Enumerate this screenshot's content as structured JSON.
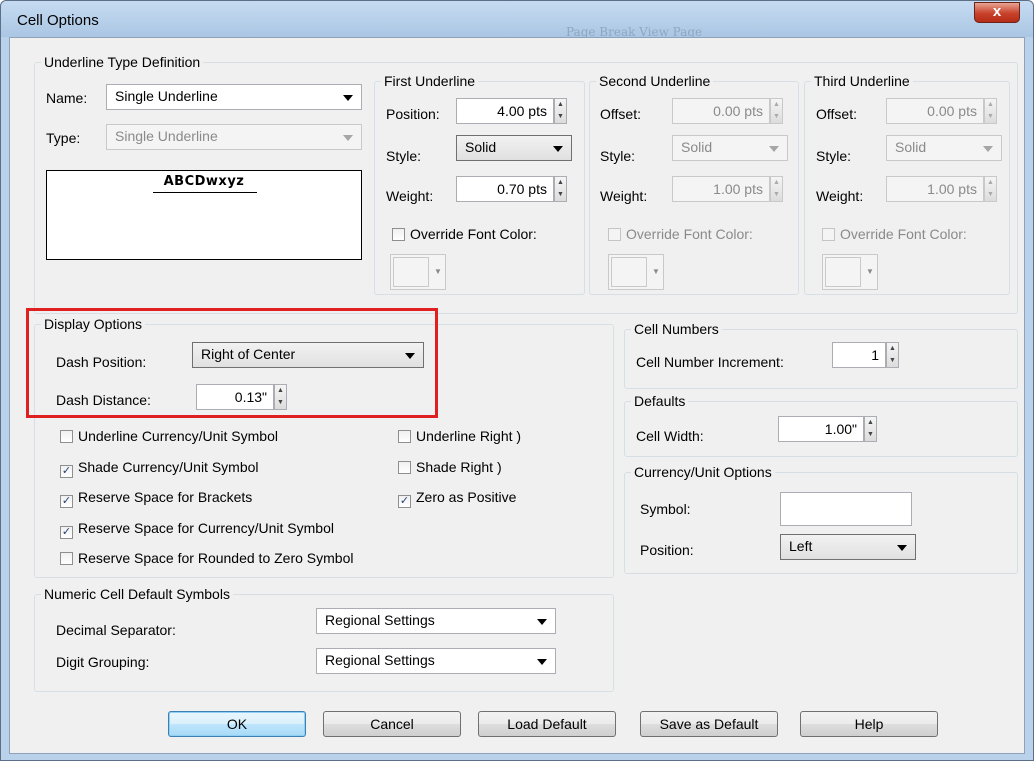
{
  "window": {
    "title": "Cell Options",
    "ghost_title": "Page Break View Page",
    "close_glyph": "x"
  },
  "underline_def": {
    "legend": "Underline Type Definition",
    "name_label": "Name:",
    "name_value": "Single Underline",
    "type_label": "Type:",
    "type_value": "Single Underline",
    "preview_text": "ABCDwxyz"
  },
  "first_underline": {
    "legend": "First Underline",
    "position_label": "Position:",
    "position_value": "4.00 pts",
    "style_label": "Style:",
    "style_value": "Solid",
    "weight_label": "Weight:",
    "weight_value": "0.70 pts",
    "override_label": "Override Font Color:"
  },
  "second_underline": {
    "legend": "Second Underline",
    "offset_label": "Offset:",
    "offset_value": "0.00 pts",
    "style_label": "Style:",
    "style_value": "Solid",
    "weight_label": "Weight:",
    "weight_value": "1.00 pts",
    "override_label": "Override Font Color:"
  },
  "third_underline": {
    "legend": "Third Underline",
    "offset_label": "Offset:",
    "offset_value": "0.00 pts",
    "style_label": "Style:",
    "style_value": "Solid",
    "weight_label": "Weight:",
    "weight_value": "1.00 pts",
    "override_label": "Override Font Color:"
  },
  "display_options": {
    "legend": "Display Options",
    "dash_position_label": "Dash Position:",
    "dash_position_value": "Right of Center",
    "dash_distance_label": "Dash Distance:",
    "dash_distance_value": "0.13\"",
    "checkboxes": [
      {
        "label": "Underline Currency/Unit Symbol",
        "checked": false
      },
      {
        "label": "Shade Currency/Unit Symbol",
        "checked": true
      },
      {
        "label": "Reserve Space for Brackets",
        "checked": true
      },
      {
        "label": "Reserve Space for Currency/Unit Symbol",
        "checked": true
      },
      {
        "label": "Reserve Space for Rounded to Zero Symbol",
        "checked": false
      },
      {
        "label": "Underline Right )",
        "checked": false
      },
      {
        "label": "Shade Right )",
        "checked": false
      },
      {
        "label": "Zero as Positive",
        "checked": true
      }
    ]
  },
  "cell_numbers": {
    "legend": "Cell Numbers",
    "increment_label": "Cell Number Increment:",
    "increment_value": "1"
  },
  "defaults": {
    "legend": "Defaults",
    "cell_width_label": "Cell Width:",
    "cell_width_value": "1.00\""
  },
  "currency": {
    "legend": "Currency/Unit Options",
    "symbol_label": "Symbol:",
    "symbol_value": "",
    "position_label": "Position:",
    "position_value": "Left"
  },
  "numeric": {
    "legend": "Numeric Cell Default Symbols",
    "decimal_label": "Decimal Separator:",
    "decimal_value": "Regional Settings",
    "grouping_label": "Digit Grouping:",
    "grouping_value": "Regional Settings"
  },
  "buttons": {
    "ok": "OK",
    "cancel": "Cancel",
    "load_default": "Load Default",
    "save_default": "Save as Default",
    "help": "Help"
  },
  "colors": {
    "highlight": "#e02020",
    "title_bar": "#b9d1ea",
    "close_button": "#c8412b"
  }
}
